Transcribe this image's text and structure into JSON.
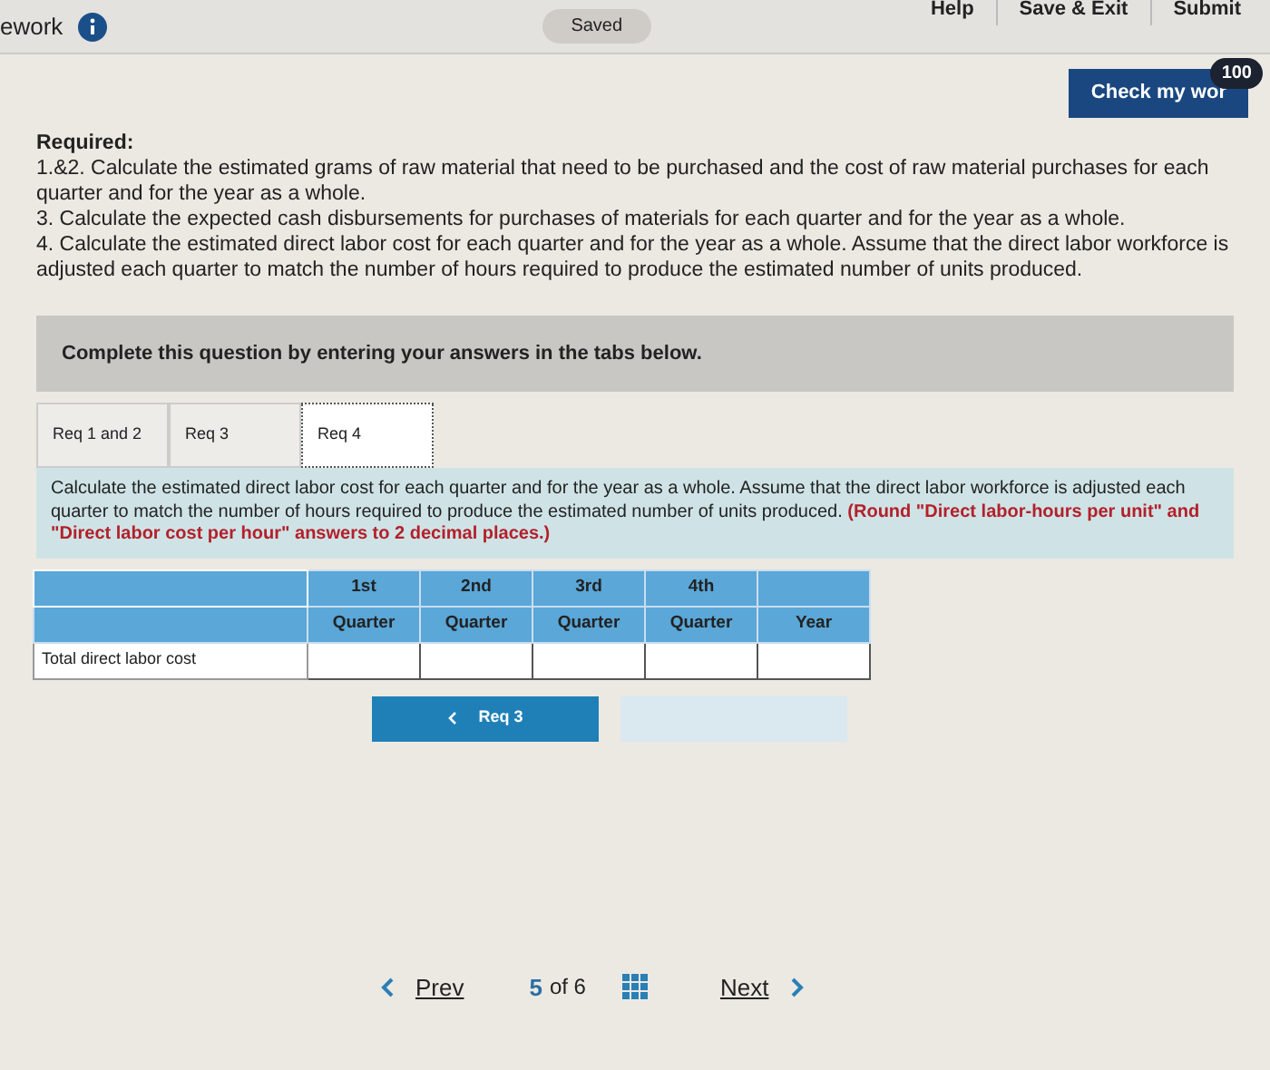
{
  "header": {
    "title": "ework",
    "saved": "Saved",
    "links": [
      "Help",
      "Save & Exit",
      "Submit"
    ]
  },
  "check": {
    "label": "Check my wor",
    "badge": "100"
  },
  "required": {
    "heading": "Required:",
    "items": [
      "1.&2. Calculate the estimated grams of raw material that need to be purchased and the cost of raw material purchases for each quarter and for the year as a whole.",
      "3. Calculate the expected cash disbursements for purchases of materials for each quarter and for the year as a whole.",
      "4. Calculate the estimated direct labor cost for each quarter and for the year as a whole. Assume that the direct labor workforce is adjusted each quarter to match the number of hours required to produce the estimated number of units produced."
    ]
  },
  "banner": "Complete this question by entering your answers in the tabs below.",
  "tabs": [
    {
      "label": "Req 1 and 2",
      "selected": false
    },
    {
      "label": "Req 3",
      "selected": false
    },
    {
      "label": "Req 4",
      "selected": true
    }
  ],
  "instruction": {
    "text": "Calculate the estimated direct labor cost for each quarter and for the year as a whole. Assume that the direct labor workforce is adjusted each quarter to match the number of hours required to produce the estimated number of units produced.",
    "note": "(Round \"Direct labor-hours per unit\" and \"Direct labor cost per hour\" answers to 2 decimal places.)"
  },
  "table": {
    "columns": [
      {
        "top": "1st",
        "bottom": "Quarter"
      },
      {
        "top": "2nd",
        "bottom": "Quarter"
      },
      {
        "top": "3rd",
        "bottom": "Quarter"
      },
      {
        "top": "4th",
        "bottom": "Quarter"
      },
      {
        "bottom": "Year"
      }
    ],
    "rows": [
      {
        "label": "Total direct labor cost"
      }
    ]
  },
  "nav": {
    "prev": "Req 3",
    "next_disabled": true
  },
  "pager": {
    "prev": "Prev",
    "current": "5",
    "of": "of 6",
    "next": "Next"
  }
}
